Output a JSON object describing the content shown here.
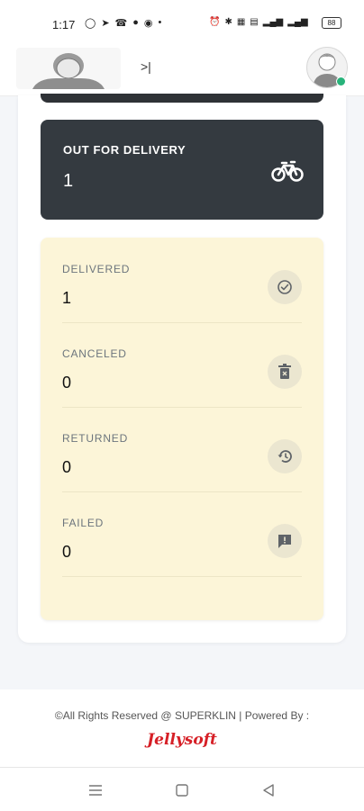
{
  "status_bar": {
    "time": "1:17",
    "left_icons": [
      "whatsapp-icon",
      "telegram-icon",
      "whatsapp-icon",
      "message-icon",
      "facebook-icon",
      "dot-icon"
    ],
    "right_icons": [
      "alarm-icon",
      "bluetooth-icon",
      "data-speed-icon",
      "volte-icon",
      "signal-icon",
      "signal-icon"
    ],
    "battery": "88"
  },
  "header": {
    "logo": "company-logo",
    "toggle_label": ">|",
    "avatar": "user-avatar"
  },
  "out_for_delivery": {
    "label": "OUT FOR DELIVERY",
    "value": "1",
    "icon": "bicycle-icon"
  },
  "statuses": [
    {
      "label": "DELIVERED",
      "value": "1",
      "icon": "check-circle-icon"
    },
    {
      "label": "CANCELED",
      "value": "0",
      "icon": "trash-icon"
    },
    {
      "label": "RETURNED",
      "value": "0",
      "icon": "history-icon"
    },
    {
      "label": "FAILED",
      "value": "0",
      "icon": "feedback-icon"
    }
  ],
  "footer": {
    "text": "©All Rights Reserved @ SUPERKLIN | Powered By :",
    "brand": "Jellysoft"
  },
  "colors": {
    "dark_card": "#343a40",
    "status_card": "#fcf5d8",
    "brand_red": "#d61f26",
    "online": "#27b37a"
  }
}
